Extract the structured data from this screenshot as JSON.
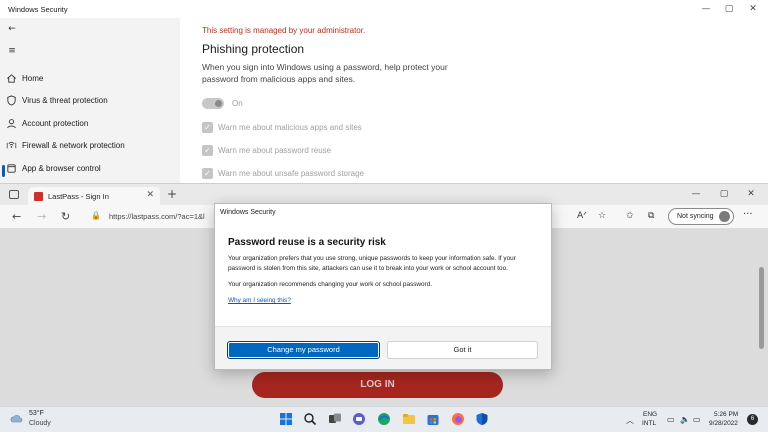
{
  "ws_window": {
    "title": "Windows Security",
    "controls": {
      "minimize": "—",
      "maximize": "▢",
      "close": "✕"
    },
    "back_icon": "back-arrow-icon",
    "menu_icon": "hamburger-menu-icon",
    "sidebar": {
      "items": [
        {
          "label": "Home",
          "icon": "home-icon"
        },
        {
          "label": "Virus & threat protection",
          "icon": "shield-icon"
        },
        {
          "label": "Account protection",
          "icon": "person-icon"
        },
        {
          "label": "Firewall & network protection",
          "icon": "wifi-icon"
        },
        {
          "label": "App & browser control",
          "icon": "app-browser-icon",
          "active": true
        }
      ]
    },
    "content": {
      "admin_note": "This setting is managed by your administrator.",
      "section_title": "Phishing protection",
      "section_desc": "When you sign into Windows using a password, help protect your password from malicious apps and sites.",
      "toggle_label": "On",
      "checkboxes": [
        "Warn me about malicious apps and sites",
        "Warn me about password reuse",
        "Warn me about unsafe password storage"
      ]
    }
  },
  "edge": {
    "tab_label": "LastPass - Sign In",
    "tab_close": "✕",
    "new_tab": "+",
    "url": "https://lastpass.com/?ac=1&l",
    "sync_label": "Not syncing",
    "more": "···",
    "controls": {
      "minimize": "—",
      "maximize": "▢",
      "close": "✕"
    },
    "page": {
      "login_button": "LOG IN"
    }
  },
  "dialog": {
    "title": "Windows Security",
    "heading": "Password reuse is a security risk",
    "body1": "Your organization prefers that you use strong, unique passwords to keep your information safe. If your password is stolen from this site, attackers can use it to break into your work or school account too.",
    "body2": "Your organization recommends changing your work or school password.",
    "link": "Why am I seeing this?",
    "primary_button": "Change my password",
    "secondary_button": "Got it"
  },
  "taskbar": {
    "weather_temp": "53°F",
    "weather_desc": "Cloudy",
    "lang_top": "ENG",
    "lang_bottom": "INTL",
    "time": "5:26 PM",
    "date": "9/28/2022",
    "notification_count": "6",
    "apps": [
      "windows-start-icon",
      "search-icon",
      "task-view-icon",
      "chat-icon",
      "edge-icon",
      "file-explorer-icon",
      "store-icon",
      "firefox-icon",
      "windows-security-icon"
    ]
  }
}
